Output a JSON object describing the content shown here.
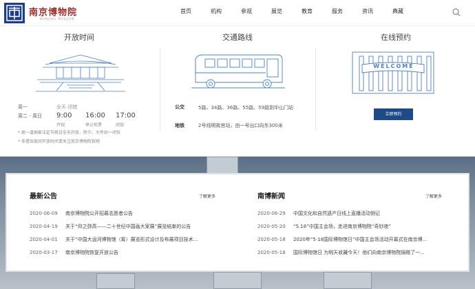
{
  "header": {
    "logo_text": "南京博物院",
    "logo_sub": "NANJING MUSEUM",
    "nav": [
      "首页",
      "机构",
      "参观",
      "展览",
      "教育",
      "服务",
      "资讯",
      "典藏"
    ],
    "search_icon": "search-icon"
  },
  "hours": {
    "title": "开放时间",
    "monday_label": "周一",
    "monday_value": "全天 闭馆",
    "weekday_label": "周二 - 周日",
    "times": [
      {
        "time": "9:00",
        "label": "开馆"
      },
      {
        "time": "16:00",
        "label": "停止检票"
      },
      {
        "time": "17:00",
        "label": "闭馆"
      }
    ],
    "notes": [
      "* 周一逢国家法定节假日全天开放，除夕、大年初一闭馆",
      "* 非遗馆夜间开放时间请关注南京博物院官网"
    ]
  },
  "transport": {
    "title": "交通路线",
    "bus_label": "公交",
    "bus_value": "5路、34路、36路、55路、59路到中山门站",
    "metro_label": "地铁",
    "metro_value": "2号线明故宫站，由一号出口向东300米"
  },
  "booking": {
    "title": "在线预约",
    "banner_text": "WELCOME",
    "button_label": "立即预约"
  },
  "announcements": {
    "title": "最新公告",
    "more": "了解更多",
    "items": [
      {
        "date": "2020-06-09",
        "text": "南京博物院公开招募志愿者公告"
      },
      {
        "date": "2020-04-19",
        "text": "关于“仰之弥高——二十世纪中国画大家展”展览结束的公告"
      },
      {
        "date": "2020-04-01",
        "text": "关于“中国大运河博物馆（筹）展览形式设计及布展项目技术..."
      },
      {
        "date": "2020-03-17",
        "text": "南京博物院恢复开放公告"
      }
    ]
  },
  "news": {
    "title": "南博新闻",
    "more": "了解更多",
    "items": [
      {
        "date": "2020-06-29",
        "text": "中国文化和自然遗产日线上直播活动侧记"
      },
      {
        "date": "2020-05-20",
        "text": "“5.18”中国主会场，走进南京博物院“奇妙夜”"
      },
      {
        "date": "2020-05-18",
        "text": "2020年“5·18国际博物馆日”中国主会场活动开幕式在南京博..."
      },
      {
        "date": "2020-05-18",
        "text": "国际博物馆日 为明天收藏今天！他们向南京博物院捐赠了一..."
      }
    ]
  },
  "colors": {
    "brand_blue": "#1e4a8a",
    "logo_red": "#9a2c2c"
  }
}
